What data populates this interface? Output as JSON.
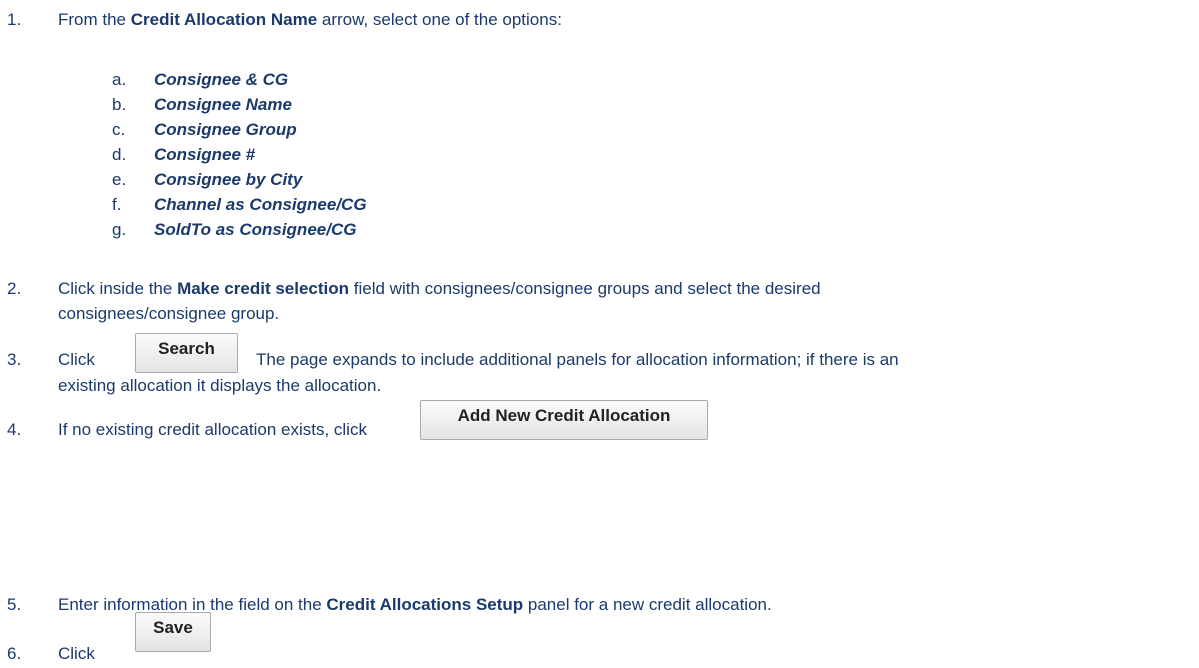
{
  "steps": {
    "s1": {
      "num": "1.",
      "pre": "From the ",
      "bold": "Credit Allocation Name",
      "post": " arrow, select one of the options:"
    },
    "options": [
      {
        "letter": "a.",
        "label": "Consignee & CG"
      },
      {
        "letter": "b.",
        "label": "Consignee Name"
      },
      {
        "letter": "c.",
        "label": "Consignee Group"
      },
      {
        "letter": "d.",
        "label": "Consignee #"
      },
      {
        "letter": "e.",
        "label": "Consignee by City"
      },
      {
        "letter": "f.",
        "label": "Channel as Consignee/CG"
      },
      {
        "letter": "g.",
        "label": "SoldTo as Consignee/CG"
      }
    ],
    "s2": {
      "num": "2.",
      "pre": "Click inside the ",
      "bold": "Make credit selection",
      "post": " field with consignees/consignee groups and select the desired",
      "line2": "consignees/consignee group."
    },
    "s3": {
      "num": "3.",
      "pre": "Click",
      "button": "Search",
      "post": "The page expands to include additional panels for allocation information; if there is an",
      "line2": "existing allocation it displays the allocation."
    },
    "s4": {
      "num": "4.",
      "pre": "If no existing credit allocation exists, click",
      "button": "Add New Credit Allocation"
    },
    "s5": {
      "num": "5.",
      "pre": "Enter information in the field on the ",
      "bold": "Credit Allocations Setup",
      "post": " panel for a new credit allocation."
    },
    "s6": {
      "num": "6.",
      "pre": "Click",
      "button": "Save"
    }
  }
}
